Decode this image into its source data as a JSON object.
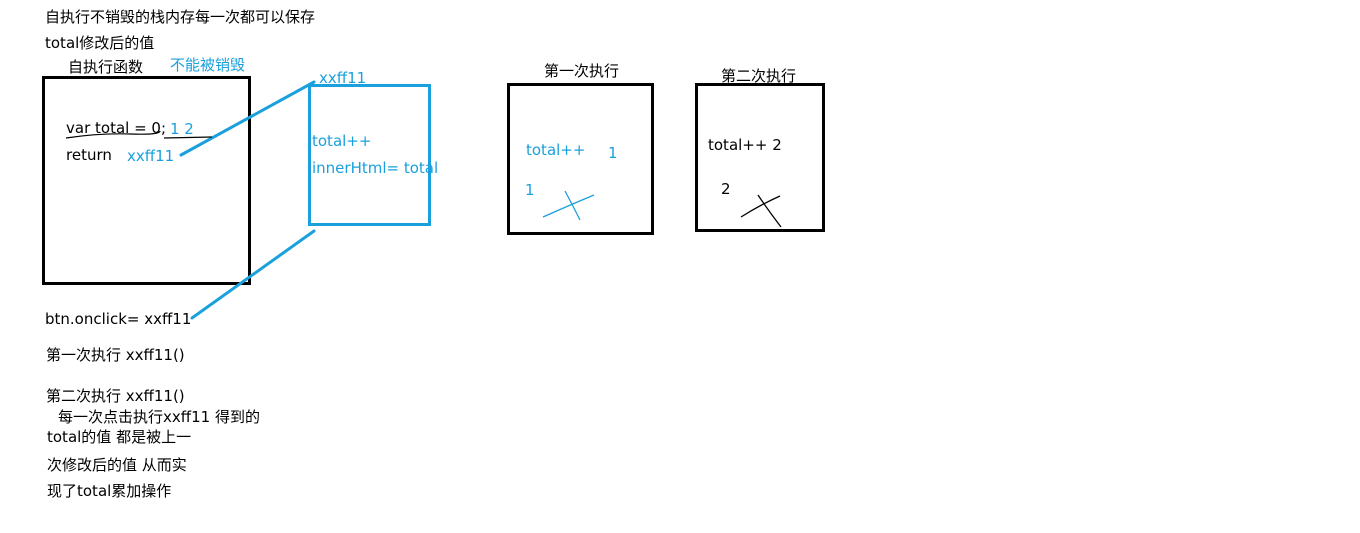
{
  "notes": {
    "line1": "自执行不销毁的栈内存每一次都可以保存",
    "line2": "total修改后的值"
  },
  "closure_box": {
    "title": "自执行函数",
    "title_note": "不能被销毁",
    "var_line": "var total = 0;",
    "values": "1  2",
    "return_kw": "return",
    "return_ref": "xxff11"
  },
  "heap_box": {
    "address": "xxff11",
    "line1": "total++",
    "line2": "innerHtml= total"
  },
  "exec1": {
    "title": "第一次执行",
    "op": "total++",
    "result": "1",
    "old_value": "1"
  },
  "exec2": {
    "title": "第二次执行",
    "op": "total++ 2",
    "old_value": "2"
  },
  "bottom": {
    "bind": "btn.onclick= xxff11",
    "call1": "第一次执行 xxff11()",
    "call2": "第二次执行 xxff11()",
    "explain1": "每一次点击执行xxff11 得到的",
    "explain2": "total的值 都是被上一",
    "explain3": "次修改后的值 从而实",
    "explain4": "现了total累加操作"
  },
  "colors": {
    "ink": "#000000",
    "accent": "#1aa0dc"
  }
}
